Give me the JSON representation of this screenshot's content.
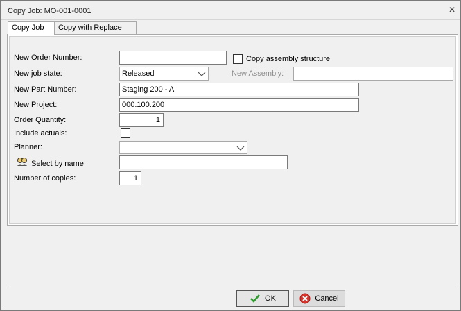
{
  "window": {
    "title": "Copy Job:  MO-001-0001"
  },
  "tabs": [
    {
      "label": "Copy Job",
      "active": true
    },
    {
      "label": "Copy with Replace",
      "active": false
    }
  ],
  "form": {
    "new_order_number": {
      "label": "New Order Number:",
      "value": ""
    },
    "copy_assembly": {
      "label": "Copy assembly structure",
      "checked": false
    },
    "new_job_state": {
      "label": "New job state:",
      "value": "Released"
    },
    "new_assembly": {
      "label": "New Assembly:",
      "value": ""
    },
    "new_part_number": {
      "label": "New Part Number:",
      "value": "Staging 200 - A"
    },
    "new_project": {
      "label": "New Project:",
      "value": "000.100.200"
    },
    "order_quantity": {
      "label": "Order Quantity:",
      "value": "1"
    },
    "include_actuals": {
      "label": "Include actuals:",
      "checked": false
    },
    "planner": {
      "label": "Planner:",
      "value": ""
    },
    "select_by_name": {
      "label": "Select by name",
      "value": ""
    },
    "number_of_copies": {
      "label": "Number of copies:",
      "value": "1"
    }
  },
  "buttons": {
    "ok": "OK",
    "cancel": "Cancel"
  },
  "icons": {
    "close": "close-icon",
    "combo": "chevron-down-icon",
    "people": "people-icon",
    "ok": "checkmark-icon",
    "cancel": "cancel-icon"
  },
  "colors": {
    "ok_check": "#2e9b2e",
    "cancel_red": "#d9342b"
  }
}
